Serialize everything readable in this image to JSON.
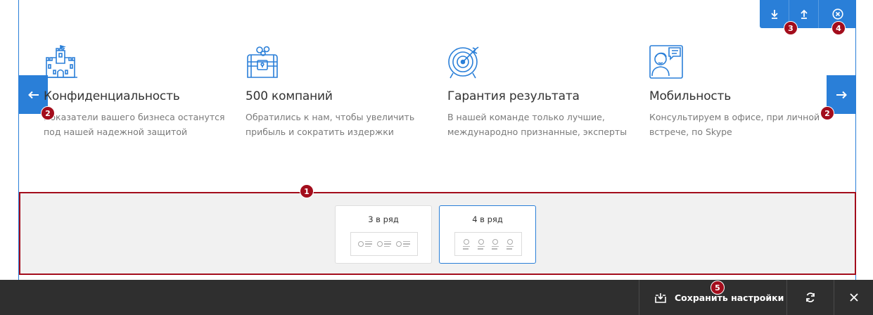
{
  "features": [
    {
      "title": "Конфиденциальность",
      "desc1": "Показатели вашего бизнеса останутся",
      "desc2": "под нашей надежной защитой",
      "icon": "castle-icon"
    },
    {
      "title": "500 компаний",
      "desc1": "Обратились к нам, чтобы увеличить",
      "desc2": "прибыль и сократить издержки",
      "icon": "treasure-chest-icon"
    },
    {
      "title": "Гарантия результата",
      "desc1": "В нашей команде только лучшие,",
      "desc2": "международно признанные, эксперты",
      "icon": "target-icon"
    },
    {
      "title": "Мобильность",
      "desc1": "Консультируем в офисе, при личной",
      "desc2": "встрече, по Skype",
      "icon": "consultant-icon"
    }
  ],
  "layout_options": [
    {
      "label": "3 в ряд",
      "selected": false
    },
    {
      "label": "4 в ряд",
      "selected": true
    }
  ],
  "top_tools": [
    "move-down-icon",
    "move-up-icon",
    "close-circle-icon"
  ],
  "bottom_bar": {
    "save_label": "Сохранить настройки"
  },
  "markers": {
    "m1": "1",
    "m2a": "2",
    "m2b": "2",
    "m3": "3",
    "m4": "4",
    "m5": "5"
  },
  "colors": {
    "accent": "#2a7fd8",
    "marker": "#a30d1c",
    "bar": "#2f2f2f"
  }
}
